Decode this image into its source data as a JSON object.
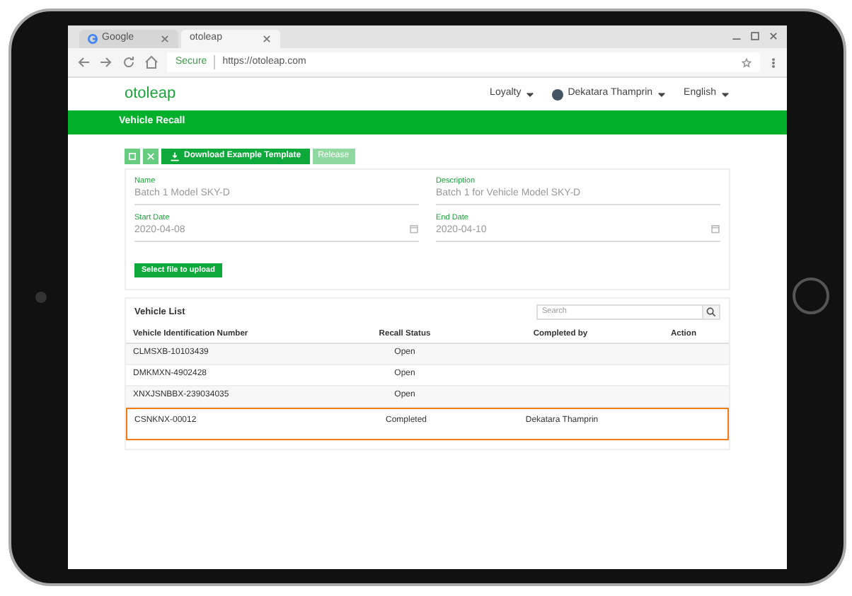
{
  "browser": {
    "tabs": [
      {
        "label": "Google",
        "selected": false
      },
      {
        "label": "otoleap",
        "selected": true
      }
    ],
    "secure_label": "Secure",
    "url": "https://otoleap.com"
  },
  "header": {
    "logo": "otoleap",
    "menus": [
      {
        "label": "Loyalty",
        "kind": "plain"
      },
      {
        "label": "Dekatara Thamprin",
        "kind": "user"
      },
      {
        "label": "English",
        "kind": "plain"
      }
    ]
  },
  "page_title": "Vehicle Recall",
  "toolbar": {
    "download_label": "Download Example Template",
    "release_label": "Release"
  },
  "form": {
    "fields": [
      {
        "label": "Name",
        "value": "Batch 1 Model SKY-D",
        "kind": "text"
      },
      {
        "label": "Description",
        "value": "Batch 1 for Vehicle Model SKY-D",
        "kind": "text"
      },
      {
        "label": "Start Date",
        "value": "2020-04-08",
        "kind": "date"
      },
      {
        "label": "End Date",
        "value": "2020-04-10",
        "kind": "date"
      }
    ],
    "upload_label": "Select file to upload"
  },
  "vehicle_list": {
    "title": "Vehicle List",
    "search_placeholder": "Search",
    "columns": [
      "Vehicle Identification Number",
      "Recall Status",
      "Completed by",
      "Action"
    ],
    "rows": [
      {
        "vin": "CLMSXB-10103439",
        "status": "Open",
        "selected": false
      },
      {
        "vin": "DMKMXN-4902428",
        "status": "Open",
        "selected": false
      },
      {
        "vin": "XNXJSNBBX-239034035",
        "status": "Open",
        "selected": false
      },
      {
        "vin": "CSNKNX-00012",
        "status": "Completed",
        "completed_by": "Dekatara Thamprin",
        "selected": true
      }
    ]
  }
}
